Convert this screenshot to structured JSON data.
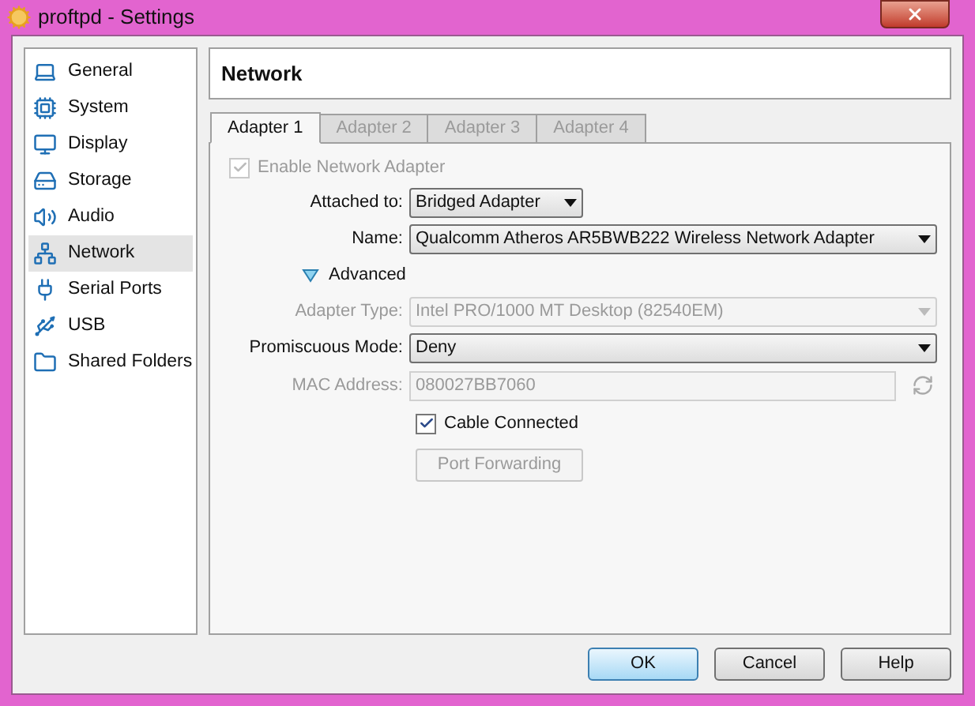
{
  "window": {
    "title": "proftpd - Settings"
  },
  "sidebar": {
    "items": [
      {
        "label": "General",
        "selected": false
      },
      {
        "label": "System",
        "selected": false
      },
      {
        "label": "Display",
        "selected": false
      },
      {
        "label": "Storage",
        "selected": false
      },
      {
        "label": "Audio",
        "selected": false
      },
      {
        "label": "Network",
        "selected": true
      },
      {
        "label": "Serial Ports",
        "selected": false
      },
      {
        "label": "USB",
        "selected": false
      },
      {
        "label": "Shared Folders",
        "selected": false
      }
    ]
  },
  "section_title": "Network",
  "tabs": [
    {
      "label": "Adapter 1",
      "selected": true
    },
    {
      "label": "Adapter 2",
      "selected": false
    },
    {
      "label": "Adapter 3",
      "selected": false
    },
    {
      "label": "Adapter 4",
      "selected": false
    }
  ],
  "form": [
    {
      "kind": "checkbox",
      "label": "Enable Network Adapter",
      "checked": true,
      "disabled": true
    },
    {
      "kind": "short-select",
      "label": "Attached to:",
      "value": "Bridged Adapter",
      "disabled": false
    },
    {
      "kind": "select",
      "label": "Name:",
      "value": "Qualcomm Atheros AR5BWB222 Wireless Network Adapter",
      "disabled": false
    },
    {
      "kind": "expander",
      "label": "Advanced",
      "expanded": true
    },
    {
      "kind": "select",
      "label": "Adapter Type:",
      "value": "Intel PRO/1000 MT Desktop (82540EM)",
      "disabled": true
    },
    {
      "kind": "select",
      "label": "Promiscuous Mode:",
      "value": "Deny",
      "disabled": false
    },
    {
      "kind": "text",
      "label": "MAC Address:",
      "value": "080027BB7060",
      "disabled": true
    },
    {
      "kind": "checkbox",
      "label": "Cable Connected",
      "checked": true,
      "disabled": false
    },
    {
      "kind": "button",
      "label": "Port Forwarding",
      "disabled": true
    }
  ],
  "buttons": [
    {
      "label": "OK",
      "default": true
    },
    {
      "label": "Cancel",
      "default": false
    },
    {
      "label": "Help",
      "default": false
    }
  ]
}
